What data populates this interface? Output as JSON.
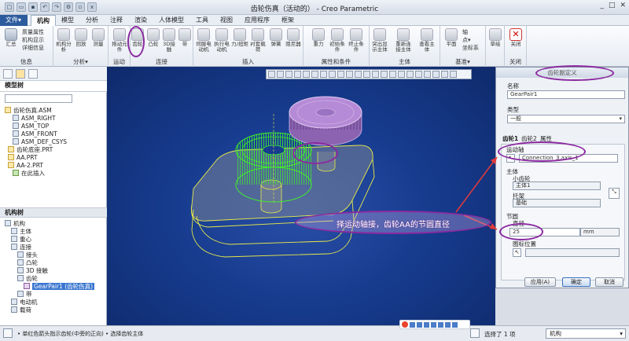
{
  "window": {
    "title": "齿轮伤真（活动的） - Creo Parametric",
    "controls": [
      "_",
      "□",
      "✕"
    ]
  },
  "menubar": {
    "items": [
      "文件▾",
      "机构",
      "模型",
      "分析",
      "注释",
      "渲染",
      "人体模型",
      "工具",
      "视图",
      "应用程序",
      "框架"
    ],
    "active": "机构"
  },
  "ribbon": {
    "groups": [
      {
        "label": "信息",
        "buttons": [
          "汇总"
        ],
        "small": [
          "质量属性",
          "机构显示",
          "详细信息"
        ]
      },
      {
        "label": "分析▾",
        "buttons": [
          "机构分析",
          "回放",
          "测量"
        ]
      },
      {
        "label": "运动",
        "buttons": [
          "拖动元件"
        ]
      },
      {
        "label": "连接",
        "buttons": [
          "齿轮",
          "凸轮",
          "3D接触",
          "带"
        ]
      },
      {
        "label": "插入",
        "buttons": [
          "伺服电动机",
          "执行电动机",
          "力/扭矩",
          "衬套载荷",
          "弹簧",
          "阻尼器"
        ]
      },
      {
        "label": "属性和条件",
        "buttons": [
          "重力",
          "初始条件",
          "终止条件"
        ]
      },
      {
        "label": "主体",
        "buttons": [
          "突出显示主体",
          "重新连接主体",
          "查看主体"
        ]
      },
      {
        "label": "基准▾",
        "buttons": [
          "平面"
        ],
        "small": [
          "轴",
          "点▾",
          "坐标系"
        ]
      },
      {
        "label": "",
        "buttons": [
          "草绘"
        ]
      },
      {
        "label": "关闭",
        "buttons": [
          "关闭"
        ]
      }
    ]
  },
  "model_tree": {
    "header": "模型树",
    "items": [
      "齿轮伤真.ASM",
      "ASM_RIGHT",
      "ASM_TOP",
      "ASM_FRONT",
      "ASM_DEF_CSYS",
      "齿轮底座.PRT",
      "AA.PRT",
      "AA-2.PRT",
      "在此插入"
    ]
  },
  "mech_tree": {
    "header": "机构树",
    "items": [
      "机构",
      "主体",
      "重心",
      "连接",
      "接头",
      "凸轮",
      "3D 接触",
      "齿轮",
      "GearPair1 (齿轮伤真)",
      "带",
      "电动机",
      "载荷"
    ],
    "selected": "GearPair1 (齿轮伤真)"
  },
  "dialog": {
    "title": "齿轮副定义",
    "name_label": "名称",
    "name_value": "GearPair1",
    "type_label": "类型",
    "type_value": "一般",
    "tabs": [
      "齿轮1",
      "齿轮2",
      "属性"
    ],
    "motion_axis_label": "运动轴",
    "motion_axis_value": "Connection_3.axis_1",
    "body_label": "主体",
    "small_gear_label": "小齿轮",
    "small_gear_value": "主体1",
    "carrier_label": "托架",
    "carrier_value": "基础",
    "pitch_circle_label": "节圆",
    "diameter_label": "直径",
    "diameter_value": "25",
    "diameter_unit": "mm",
    "icon_pos_label": "图标位置",
    "buttons": {
      "apply": "应用(A)",
      "ok": "确定",
      "cancel": "取消"
    }
  },
  "callout": {
    "text": "择运动轴接，齿轮AA的节圆直径"
  },
  "statusbar": {
    "message": "• 单红色箭头指示齿轮(中旁的正向) • 选择齿轮主体",
    "selection": "选择了 1 项",
    "filter": "机构"
  },
  "colors": {
    "viewport_bg": "#173c8f",
    "gear_green": "#3ff22a",
    "gear_purple": "#b58ad6",
    "accent": "#2d5c9e",
    "annotation": "#8a2aa0"
  }
}
